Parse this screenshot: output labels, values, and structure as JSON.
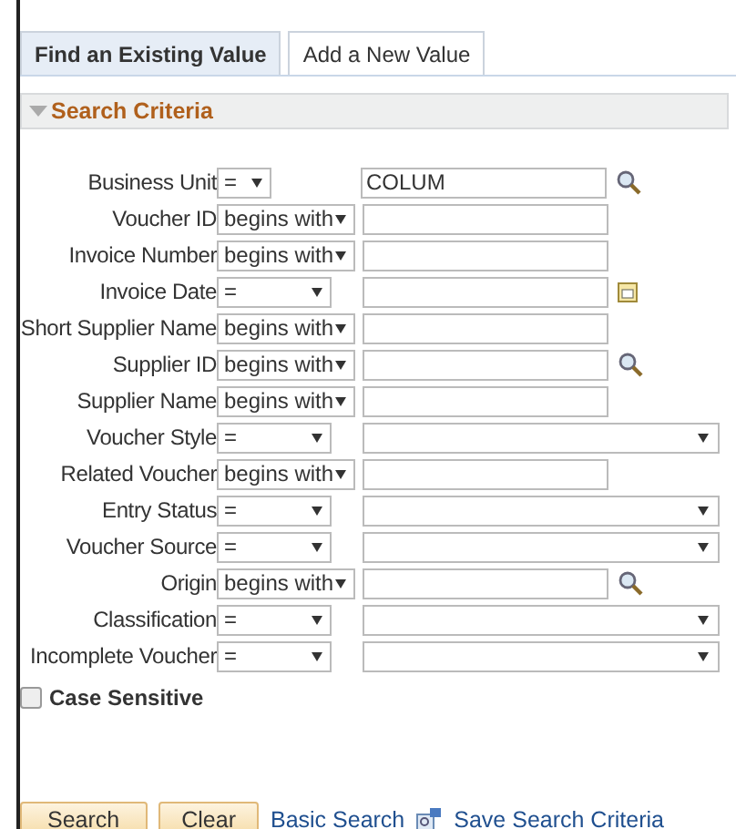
{
  "tabs": [
    {
      "label": "Find an Existing Value",
      "selected": true
    },
    {
      "label": "Add a New Value",
      "selected": false
    }
  ],
  "section": {
    "title": "Search Criteria",
    "expanded": true
  },
  "rows": [
    {
      "label": "Business Unit",
      "operator": "=",
      "kind": "lookup",
      "value": "COLUM"
    },
    {
      "label": "Voucher ID",
      "operator": "begins with",
      "kind": "text"
    },
    {
      "label": "Invoice Number",
      "operator": "begins with",
      "kind": "text"
    },
    {
      "label": "Invoice Date",
      "operator": "=",
      "kind": "date"
    },
    {
      "label": "Short Supplier Name",
      "operator": "begins with",
      "kind": "text"
    },
    {
      "label": "Supplier ID",
      "operator": "begins with",
      "kind": "lookup"
    },
    {
      "label": "Supplier Name",
      "operator": "begins with",
      "kind": "text"
    },
    {
      "label": "Voucher Style",
      "operator": "=",
      "kind": "select"
    },
    {
      "label": "Related Voucher",
      "operator": "begins with",
      "kind": "text"
    },
    {
      "label": "Entry Status",
      "operator": "=",
      "kind": "select"
    },
    {
      "label": "Voucher Source",
      "operator": "=",
      "kind": "select"
    },
    {
      "label": "Origin",
      "operator": "begins with",
      "kind": "lookup"
    },
    {
      "label": "Classification",
      "operator": "=",
      "kind": "select"
    },
    {
      "label": "Incomplete Voucher",
      "operator": "=",
      "kind": "select"
    }
  ],
  "case_sensitive": {
    "label": "Case Sensitive",
    "checked": false
  },
  "buttons": [
    "Search",
    "Clear"
  ],
  "links": [
    "Basic Search",
    "Save Search Criteria"
  ]
}
